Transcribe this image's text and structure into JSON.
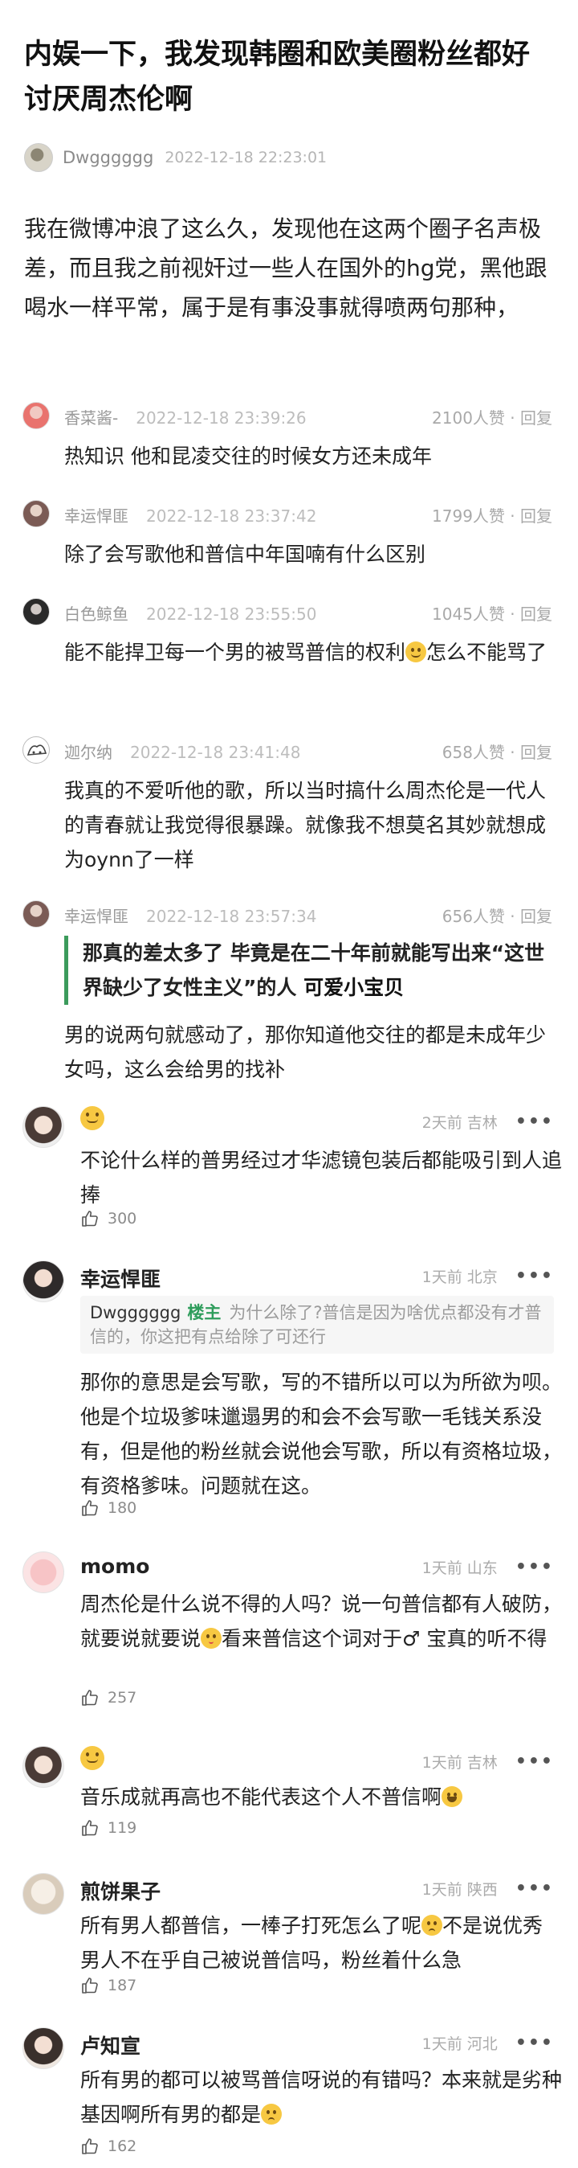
{
  "post": {
    "title": "内娱一下，我发现韩圈和欧美圈粉丝都好讨厌周杰伦啊",
    "author": "Dwgggggg",
    "time": "2022-12-18 22:23:01",
    "body": "我在微博冲浪了这么久，发现他在这两个圈子名声极差，而且我之前视奸过一些人在国外的hg党，黑他跟喝水一样平常，属于是有事没事就得喷两句那种，"
  },
  "comments_a": [
    {
      "name": "香菜酱-",
      "time": "2022-12-18 23:39:26",
      "likes": "2100人赞 · 回复",
      "text": "热知识 他和昆凌交往的时候女方还未成年"
    },
    {
      "name": "幸运悍匪",
      "time": "2022-12-18 23:37:42",
      "likes": "1799人赞 · 回复",
      "text": "除了会写歌他和普信中年国喃有什么区别"
    },
    {
      "name": "白色鲸鱼",
      "time": "2022-12-18 23:55:50",
      "likes": "1045人赞 · 回复",
      "text_before": "能不能捍卫每一个男的被骂普信的权利",
      "text_after": "怎么不能骂了"
    },
    {
      "name": "迦尔纳",
      "time": "2022-12-18 23:41:48",
      "likes": "658人赞 · 回复",
      "text": "我真的不爱听他的歌，所以当时搞什么周杰伦是一代人的青春就让我觉得很暴躁。就像我不想莫名其妙就想成为oynn了一样"
    },
    {
      "name": "幸运悍匪",
      "time": "2022-12-18 23:57:34",
      "likes": "656人赞 · 回复",
      "quote_plain": "那真的差太多了 毕竟是在二十年前就能写出来“这世界缺少了女性主义”的人",
      "quote_hl": "可爱小宝贝",
      "text": "男的说两句就感动了，那你知道他交往的都是未成年少女吗，这么会给男的找补"
    }
  ],
  "comments_b": [
    {
      "name": "",
      "meta": "2天前 吉林",
      "text": "不论什么样的普男经过才华滤镜包装后都能吸引到人追捧",
      "likes": "300"
    },
    {
      "name": "幸运悍匪",
      "meta": "1天前 北京",
      "reply_name": "Dwgggggg",
      "reply_badge": "楼主",
      "reply_text": "为什么除了?普信是因为啥优点都没有才普信的，你这把有点给除了可还行",
      "text": "那你的意思是会写歌，写的不错所以可以为所欲为呗。他是个垃圾爹味邋遢男的和会不会写歌一毛钱关系没有，但是他的粉丝就会说他会写歌，所以有资格垃圾，有资格爹味。问题就在这。",
      "likes": "180"
    },
    {
      "name": "momo",
      "meta": "1天前 山东",
      "text_before": "周杰伦是什么说不得的人吗？说一句普信都有人破防，就要说就要说",
      "text_mid": "看来普信这个词对于",
      "gender": "♂",
      "text_after": " 宝真的听不得",
      "likes": "257"
    },
    {
      "name": "",
      "meta": "1天前 吉林",
      "text": "音乐成就再高也不能代表这个人不普信啊",
      "likes": "119"
    },
    {
      "name": "煎饼果子",
      "meta": "1天前 陕西",
      "text_before": "所有男人都普信，一棒子打死怎么了呢",
      "text_after": "不是说优秀男人不在乎自己被说普信吗，粉丝着什么急",
      "likes": "187"
    },
    {
      "name": "卢知宣",
      "meta": "1天前 河北",
      "text_before": "所有男的都可以被骂普信呀说的有错吗？本来就是劣种基因啊所有男的都是",
      "likes": "162"
    }
  ],
  "icons": {
    "like": "thumbs-up-icon",
    "more": "more-dots-icon",
    "emoji_grin": "grinning-emoji-icon",
    "emoji_sweat": "sweat-smile-emoji-icon",
    "emoji_kiss": "kiss-emoji-icon",
    "emoji_pleading": "pleading-emoji-icon",
    "emoji_laugh": "laughing-emoji-icon"
  },
  "colors": {
    "quote_bar": "#3c9b5c",
    "op_badge": "#2f9d5c"
  }
}
